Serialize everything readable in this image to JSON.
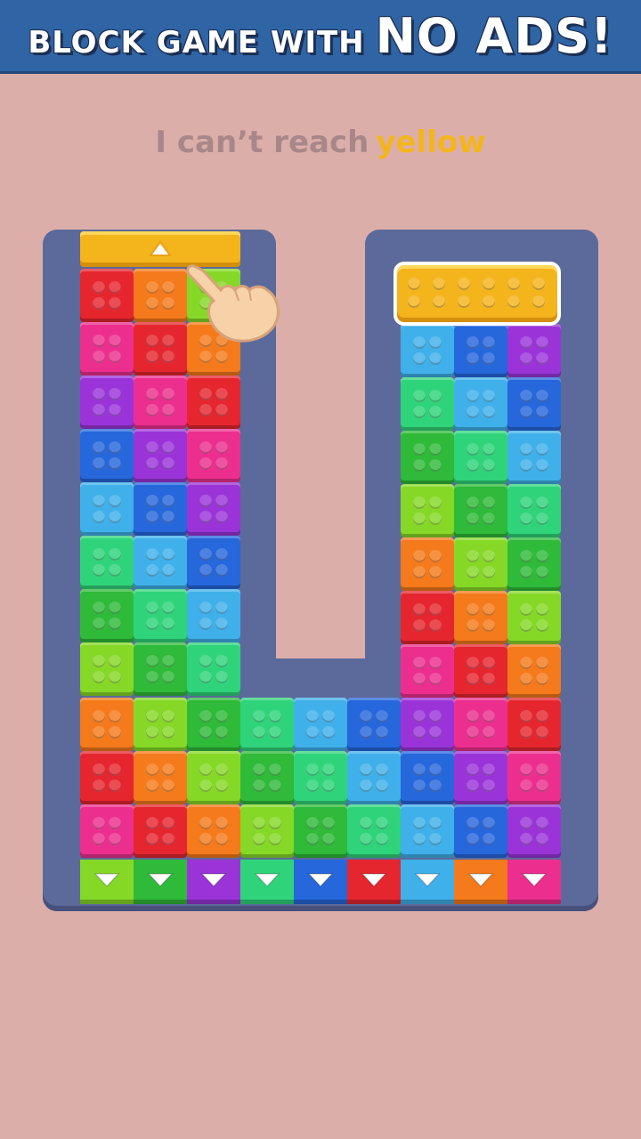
{
  "banner": {
    "small_text": "BLOCK GAME WITH",
    "big_text": "NO ADS!"
  },
  "hint": {
    "prefix": "I can’t reach",
    "highlight": "yellow"
  },
  "colors": {
    "red": "#e6262f",
    "orange": "#f57a1b",
    "yellow": "#f4b41c",
    "lime": "#86d827",
    "green": "#2fba39",
    "mint": "#2fd47a",
    "cyan": "#3fb0ea",
    "blue": "#2667dc",
    "purple": "#9a34d9",
    "pink": "#ec2f8e",
    "board": "#5c6a9b",
    "background": "#dcaeaa",
    "banner": "#2f64a5"
  },
  "board": {
    "left_grid": [
      [
        "red",
        "orange",
        "lime"
      ],
      [
        "pink",
        "red",
        "orange"
      ],
      [
        "purple",
        "pink",
        "red"
      ],
      [
        "blue",
        "purple",
        "pink"
      ],
      [
        "cyan",
        "blue",
        "purple"
      ],
      [
        "mint",
        "cyan",
        "blue"
      ],
      [
        "green",
        "mint",
        "cyan"
      ],
      [
        "lime",
        "green",
        "mint"
      ]
    ],
    "right_grid": [
      [
        "cyan",
        "blue",
        "purple"
      ],
      [
        "mint",
        "cyan",
        "blue"
      ],
      [
        "green",
        "mint",
        "cyan"
      ],
      [
        "lime",
        "green",
        "mint"
      ],
      [
        "orange",
        "lime",
        "green"
      ],
      [
        "red",
        "orange",
        "lime"
      ],
      [
        "pink",
        "red",
        "orange"
      ]
    ],
    "bottom_grid": [
      [
        "orange",
        "lime",
        "green",
        "mint",
        "cyan",
        "blue",
        "purple",
        "pink",
        "red"
      ],
      [
        "red",
        "orange",
        "lime",
        "green",
        "mint",
        "cyan",
        "blue",
        "purple",
        "pink"
      ],
      [
        "pink",
        "red",
        "orange",
        "lime",
        "green",
        "mint",
        "cyan",
        "blue",
        "purple"
      ]
    ],
    "exits": [
      "lime",
      "green",
      "purple",
      "mint",
      "blue",
      "red",
      "cyan",
      "orange",
      "pink"
    ],
    "yellow_pieces": [
      {
        "name": "yellow-gate",
        "orientation": "vertical-slot-top"
      },
      {
        "name": "yellow-bar-selected",
        "orientation": "horizontal"
      }
    ]
  },
  "icons": {
    "gate_arrow": "up-arrow-icon",
    "exit_arrow": "down-triangle-icon",
    "pointer": "pointing-hand-icon"
  }
}
